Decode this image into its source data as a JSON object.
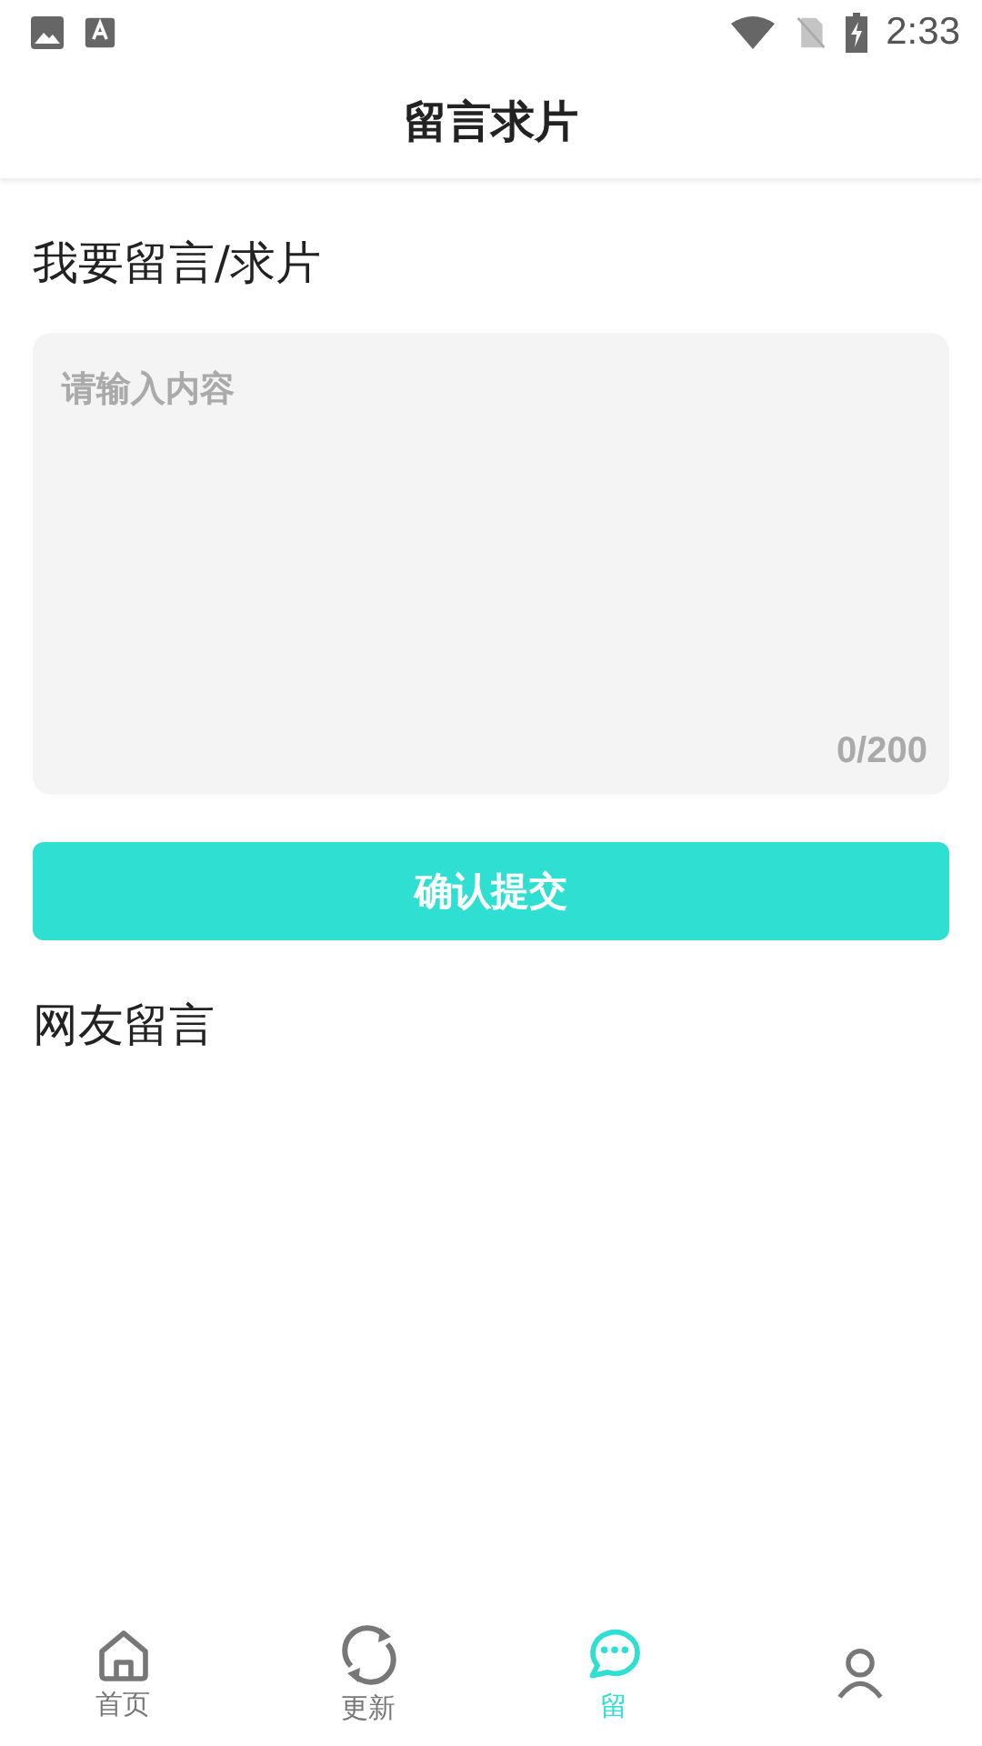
{
  "status_bar": {
    "time": "2:33"
  },
  "header": {
    "title": "留言求片"
  },
  "compose": {
    "heading": "我要留言/求片",
    "placeholder": "请输入内容",
    "counter": "0/200",
    "submit": "确认提交"
  },
  "comments": {
    "heading": "网友留言"
  },
  "tabs": [
    {
      "kind": "home",
      "label": "首页",
      "selected": false
    },
    {
      "kind": "refresh",
      "label": "更新",
      "selected": false
    },
    {
      "kind": "chat",
      "label": "留",
      "selected": true
    },
    {
      "kind": "person",
      "selected": false
    }
  ]
}
